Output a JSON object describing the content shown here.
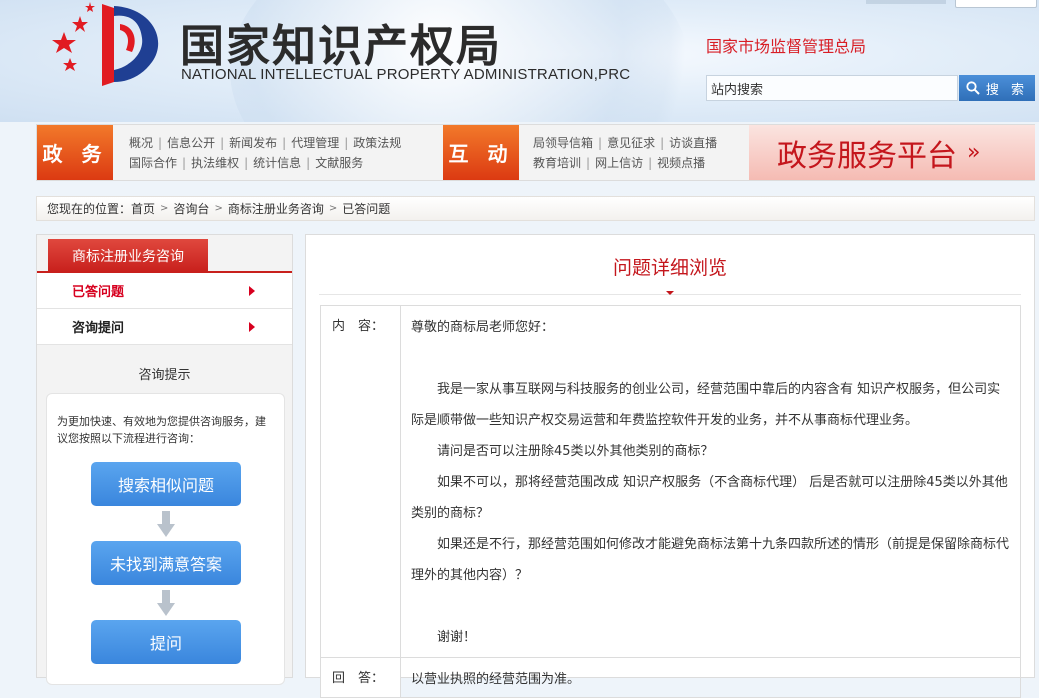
{
  "header": {
    "logo_cn": "国家知识产权局",
    "logo_en": "NATIONAL INTELLECTUAL PROPERTY ADMINISTRATION,PRC",
    "samr_link": "国家市场监督管理总局",
    "search_placeholder": "站内搜索",
    "search_value": "站内搜索",
    "search_button": "搜 索"
  },
  "nav": {
    "section1": {
      "label": "政 务",
      "row1": [
        "概况",
        "信息公开",
        "新闻发布",
        "代理管理",
        "政策法规"
      ],
      "row2": [
        "国际合作",
        "执法维权",
        "统计信息",
        "文献服务"
      ]
    },
    "section2": {
      "label": "互 动",
      "row1": [
        "局领导信箱",
        "意见征求",
        "访谈直播"
      ],
      "row2": [
        "教育培训",
        "网上信访",
        "视频点播"
      ]
    },
    "platform": "政务服务平台",
    "platform_arrow": "»"
  },
  "breadcrumb": {
    "prefix": "您现在的位置：",
    "items": [
      "首页",
      "咨询台",
      "商标注册业务咨询",
      "已答问题"
    ]
  },
  "sidebar": {
    "title": "商标注册业务咨询",
    "items": [
      {
        "label": "已答问题",
        "active": true
      },
      {
        "label": "咨询提问",
        "active": false
      }
    ],
    "tips_title": "咨询提示",
    "tips_text": "为更加快速、有效地为您提供咨询服务，建议您按照以下流程进行咨询：",
    "flow": [
      "搜索相似问题",
      "未找到满意答案",
      "提问"
    ]
  },
  "main": {
    "title": "问题详细浏览",
    "content_label": "内　容：",
    "answer_label": "回　答：",
    "content": {
      "greeting": "尊敬的商标局老师您好：",
      "p1": "我是一家从事互联网与科技服务的创业公司，经营范围中靠后的内容含有 知识产权服务，但公司实际是顺带做一些知识产权交易运营和年费监控软件开发的业务，并不从事商标代理业务。",
      "p2": "请问是否可以注册除45类以外其他类别的商标？",
      "p3": "如果不可以，那将经营范围改成 知识产权服务（不含商标代理） 后是否就可以注册除45类以外其他类别的商标？",
      "p4": "如果还是不行，那经营范围如何修改才能避免商标法第十九条四款所述的情形（前提是保留除商标代理外的其他内容）？",
      "thanks": "谢谢！"
    },
    "answer": "以营业执照的经营范围为准。"
  },
  "colors": {
    "brand_red": "#c4161c",
    "nav_orange": "#e85a1f",
    "button_blue": "#3a86dd"
  }
}
